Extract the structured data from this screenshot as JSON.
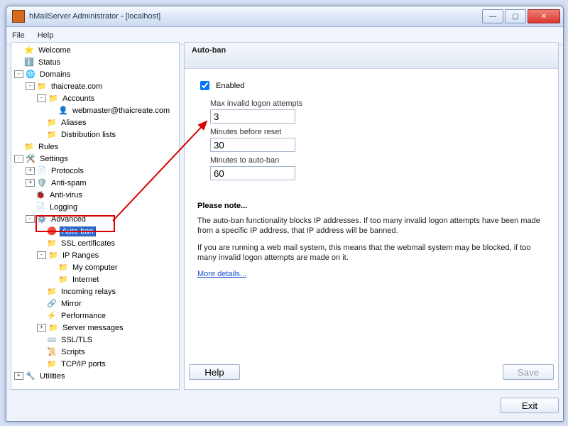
{
  "title": "hMailServer Administrator - [localhost]",
  "window_buttons": {
    "min": "—",
    "max": "▢",
    "close": "✕"
  },
  "menu": {
    "file": "File",
    "help": "Help"
  },
  "tree": {
    "welcome": "Welcome",
    "status": "Status",
    "domains": "Domains",
    "domain": "thaicreate.com",
    "accounts": "Accounts",
    "account": "webmaster@thaicreate.com",
    "aliases": "Aliases",
    "dlists": "Distribution lists",
    "rules": "Rules",
    "settings": "Settings",
    "protocols": "Protocols",
    "antispam": "Anti-spam",
    "antivirus": "Anti-virus",
    "logging": "Logging",
    "advanced": "Advanced",
    "autoban": "Auto-ban",
    "sslcert": "SSL certificates",
    "ipranges": "IP Ranges",
    "mycomputer": "My computer",
    "internet": "Internet",
    "incoming": "Incoming relays",
    "mirror": "Mirror",
    "performance": "Performance",
    "servermsg": "Server messages",
    "ssltls": "SSL/TLS",
    "scripts": "Scripts",
    "tcpip": "TCP/IP ports",
    "utilities": "Utilities"
  },
  "content": {
    "header": "Auto-ban",
    "enabled_label": "Enabled",
    "enabled_checked": true,
    "fields": {
      "max_attempts_label": "Max invalid logon attempts",
      "max_attempts_value": "3",
      "minutes_reset_label": "Minutes before reset",
      "minutes_reset_value": "30",
      "minutes_ban_label": "Minutes to auto-ban",
      "minutes_ban_value": "60"
    },
    "note_header": "Please note...",
    "note_p1": "The auto-ban functionality blocks IP addresses. If too many invalid logon attempts have been made from a specific IP address, that IP address will be banned.",
    "note_p2": "If you are running a web mail system, this means that the webmail system may be blocked, if too many invalid logon attempts are made on it.",
    "more_link": "More details...",
    "help_btn": "Help",
    "save_btn": "Save"
  },
  "footer": {
    "exit": "Exit"
  }
}
